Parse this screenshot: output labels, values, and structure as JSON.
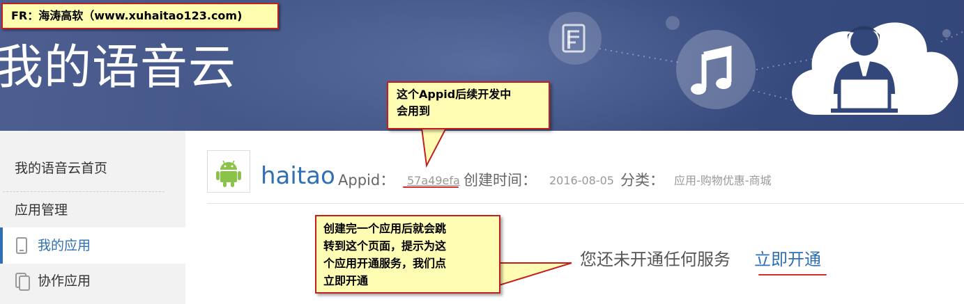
{
  "banner": {
    "title": "我的语音云",
    "icons": [
      "document-icon",
      "music-note-icon",
      "cloud-user-icon"
    ],
    "colors": {
      "background": "#3e5284",
      "title": "#ffffff"
    }
  },
  "fr_label": {
    "text": "FR：海涛高软（www.xuhaitao123.com)"
  },
  "callouts": {
    "appid_note": {
      "line1": "这个Appid后续开发中",
      "line2": "会用到"
    },
    "page_note": {
      "line1": "创建完一个应用后就会跳",
      "line2": "转到这个页面，提示为这",
      "line3": "个应用开通服务，我们点",
      "line4": "立即开通"
    }
  },
  "sidebar": {
    "items": [
      {
        "label": "我的语音云首页"
      },
      {
        "label": "应用管理"
      },
      {
        "label": "我的应用",
        "active": true,
        "icon": "phone-icon"
      },
      {
        "label": "协作应用",
        "icon": "copy-device-icon"
      }
    ],
    "accent": "#2f6fb3"
  },
  "app": {
    "icon": "android-icon",
    "name": "haitao",
    "appid_label": "Appid：",
    "appid_value": "57a49efa",
    "created_label": "创建时间：",
    "created_value": "2016-08-05",
    "category_label": "分类：",
    "category_value": "应用-购物优惠-商城"
  },
  "service": {
    "status_text": "您还未开通任何服务",
    "open_link": "立即开通"
  }
}
